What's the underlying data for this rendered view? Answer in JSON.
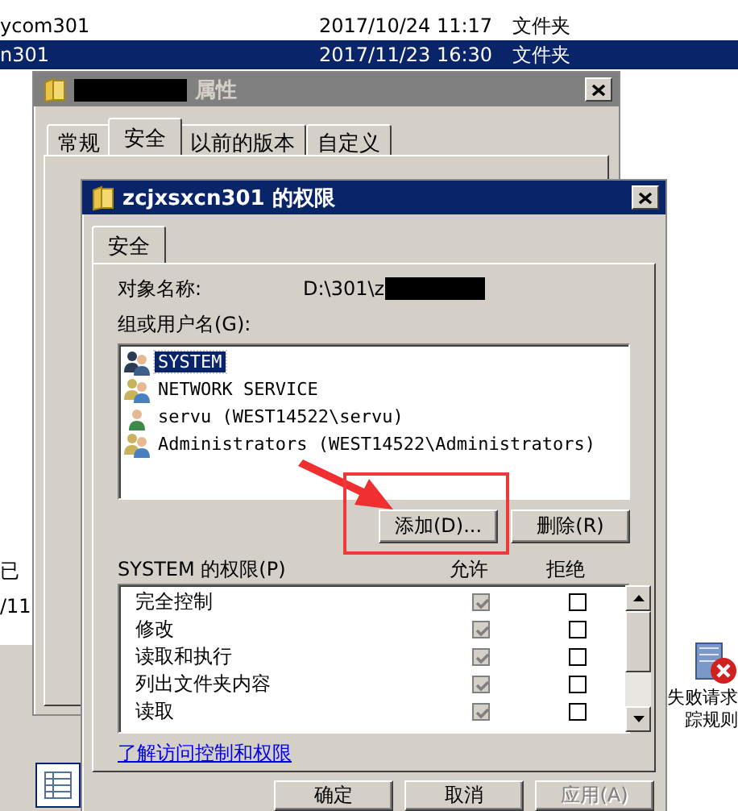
{
  "explorer": {
    "rows": [
      {
        "name": "ycom301",
        "date": "2017/10/24 11:17",
        "type": "文件夹",
        "selected": false
      },
      {
        "name": "n301",
        "date": "2017/11/23 16:30",
        "type": "文件夹",
        "selected": true
      }
    ],
    "fragments": [
      "已",
      "/11"
    ],
    "side_item": {
      "lines": [
        "失败请求",
        "踪规则"
      ]
    }
  },
  "properties_dialog": {
    "title": "属性",
    "active": false,
    "tabs": [
      {
        "label": "常规",
        "selected": false
      },
      {
        "label": "安全",
        "selected": true
      },
      {
        "label": "以前的版本",
        "selected": false
      },
      {
        "label": "自定义",
        "selected": false
      }
    ]
  },
  "permissions_dialog": {
    "title": "zcjxsxcn301 的权限",
    "active": true,
    "tabs": [
      {
        "label": "安全",
        "selected": true
      }
    ],
    "object_label": "对象名称:",
    "object_value": "D:\\301\\z",
    "groups_label": "组或用户名(G):",
    "users": [
      {
        "name": "SYSTEM",
        "kind": "system",
        "selected": true
      },
      {
        "name": "NETWORK SERVICE",
        "kind": "group",
        "selected": false
      },
      {
        "name": "servu (WEST14522\\servu)",
        "kind": "user",
        "selected": false
      },
      {
        "name": "Administrators (WEST14522\\Administrators)",
        "kind": "group",
        "selected": false
      }
    ],
    "list_buttons": [
      {
        "label": "添加(D)...",
        "disabled": false
      },
      {
        "label": "删除(R)",
        "disabled": false
      }
    ],
    "permissions_label": "SYSTEM 的权限(P)",
    "columns": [
      "允许",
      "拒绝"
    ],
    "permissions": [
      {
        "name": "完全控制",
        "allow": true,
        "allow_disabled": true,
        "deny": false
      },
      {
        "name": "修改",
        "allow": true,
        "allow_disabled": true,
        "deny": false
      },
      {
        "name": "读取和执行",
        "allow": true,
        "allow_disabled": true,
        "deny": false
      },
      {
        "name": "列出文件夹内容",
        "allow": true,
        "allow_disabled": true,
        "deny": false
      },
      {
        "name": "读取",
        "allow": true,
        "allow_disabled": true,
        "deny": false
      }
    ],
    "link": "了解访问控制和权限",
    "footer_buttons": [
      {
        "label": "确定",
        "disabled": false
      },
      {
        "label": "取消",
        "disabled": false
      },
      {
        "label": "应用(A)",
        "disabled": true
      }
    ]
  }
}
